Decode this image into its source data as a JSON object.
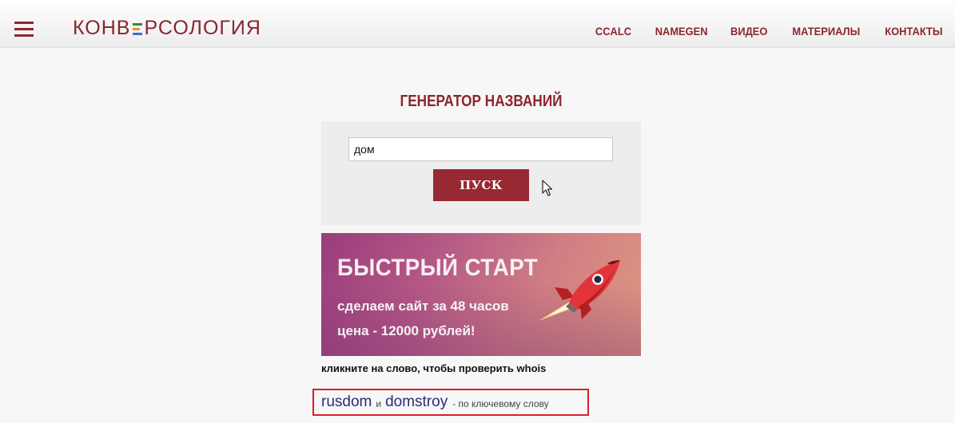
{
  "header": {
    "logo_text_left": "КОНВ",
    "logo_text_right": "РСОЛОГИЯ",
    "logo_mark_colors": [
      "#2b8a3e",
      "#e8912d",
      "#3b6fd0"
    ],
    "nav": [
      {
        "label": "CCALC"
      },
      {
        "label": "NAMEGEN"
      },
      {
        "label": "ВИДЕО"
      },
      {
        "label": "МАТЕРИАЛЫ"
      },
      {
        "label": "КОНТАКТЫ"
      }
    ]
  },
  "main": {
    "title": "ГЕНЕРАТОР НАЗВАНИЙ",
    "search": {
      "value": "дом",
      "placeholder": ""
    },
    "go_button_label": "ПУСК"
  },
  "banner": {
    "title": "БЫСТРЫЙ СТАРТ",
    "line1": "сделаем сайт за 48 часов",
    "line2": "цена - 12000 рублей!"
  },
  "results": {
    "hint": "кликните на слово, чтобы проверить whois",
    "keywords": [
      {
        "word": "rusdom"
      },
      {
        "word": "domstroy"
      }
    ],
    "separator": "и",
    "suffix": "- по ключевому слову"
  },
  "colors": {
    "brand": "#8b2630",
    "button": "#982933",
    "link": "#2e2a7a",
    "highlight_border": "#d81f26"
  }
}
